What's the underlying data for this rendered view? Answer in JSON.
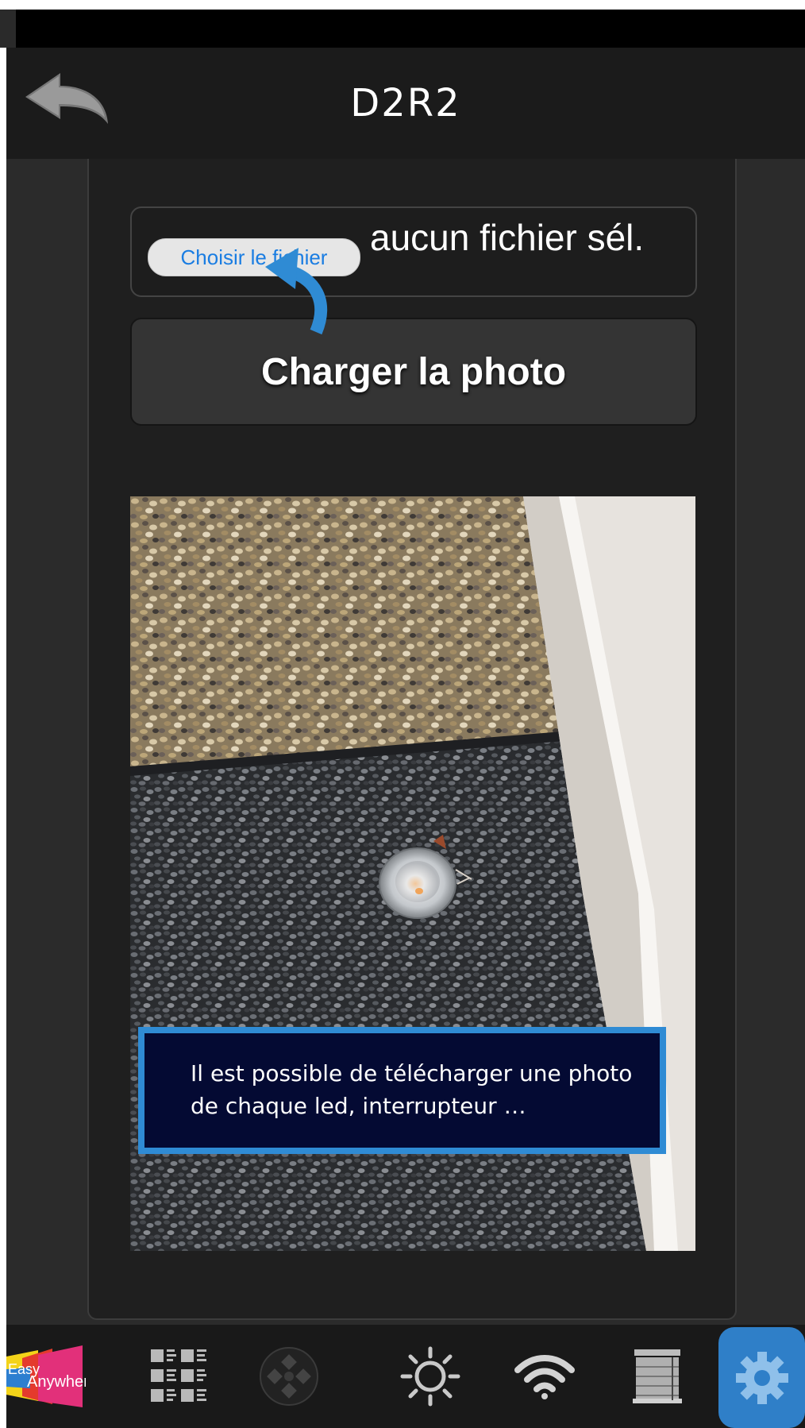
{
  "header": {
    "title": "D2R2",
    "back_icon": "back-arrow-icon"
  },
  "file_picker": {
    "button_label": "Choisir le fichier",
    "status": "aucun fichier sél."
  },
  "load_button": {
    "label": "Charger la photo"
  },
  "photo": {
    "caption_lines": [
      "Il est possible de télécharger une photo",
      "de chaque led, interrupteur …"
    ]
  },
  "bottom_nav": {
    "logo_text_1": "Easy",
    "logo_text_2": "Anywhere",
    "items": [
      "logo",
      "grid-list-icon",
      "dpad-icon",
      "sun-icon",
      "wifi-icon",
      "blinds-icon",
      "gear-icon"
    ],
    "active": "gear-icon"
  },
  "colors": {
    "accent": "#2f7fc8",
    "caption_bg": "#040a33",
    "caption_border": "#2f8bd4",
    "link": "#1a7de2"
  }
}
